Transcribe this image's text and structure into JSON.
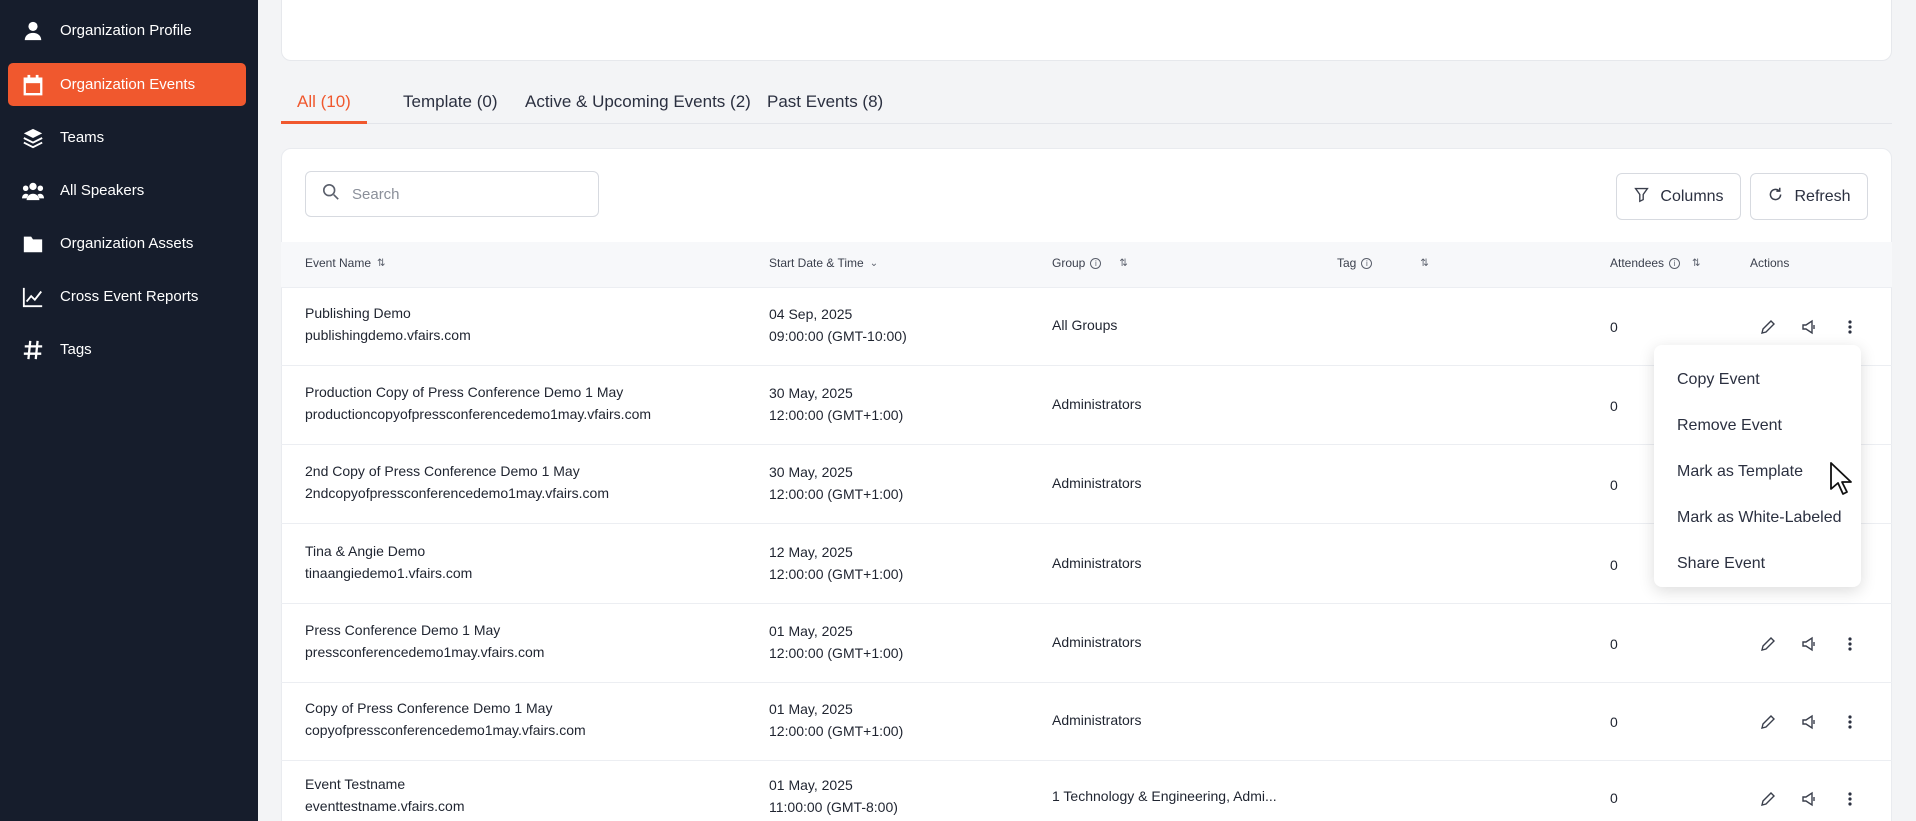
{
  "sidebar": {
    "items": [
      {
        "label": "Organization Profile",
        "icon": "user-icon"
      },
      {
        "label": "Organization Events",
        "icon": "calendar-icon",
        "active": true
      },
      {
        "label": "Teams",
        "icon": "layers-icon"
      },
      {
        "label": "All Speakers",
        "icon": "users-icon"
      },
      {
        "label": "Organization Assets",
        "icon": "folder-icon"
      },
      {
        "label": "Cross Event Reports",
        "icon": "chart-line-icon"
      },
      {
        "label": "Tags",
        "icon": "hash-icon"
      }
    ]
  },
  "tabs": [
    {
      "label": "All (10)",
      "active": true
    },
    {
      "label": "Template (0)"
    },
    {
      "label": "Active & Upcoming Events (2)"
    },
    {
      "label": "Past Events (8)"
    }
  ],
  "toolbar": {
    "search_placeholder": "Search",
    "columns_label": "Columns",
    "refresh_label": "Refresh"
  },
  "table": {
    "headers": {
      "event_name": "Event Name",
      "start_date": "Start Date & Time",
      "group": "Group",
      "tag": "Tag",
      "attendees": "Attendees",
      "actions": "Actions"
    },
    "rows": [
      {
        "name": "Publishing Demo",
        "url": "publishingdemo.vfairs.com",
        "date": "04 Sep, 2025",
        "time": "09:00:00 (GMT-10:00)",
        "group": "All Groups",
        "tag": "",
        "attendees": "0"
      },
      {
        "name": "Production Copy of Press Conference Demo 1 May",
        "url": "productioncopyofpressconferencedemo1may.vfairs.com",
        "date": "30 May, 2025",
        "time": "12:00:00 (GMT+1:00)",
        "group": "Administrators",
        "tag": "",
        "attendees": "0"
      },
      {
        "name": "2nd Copy of Press Conference Demo 1 May",
        "url": "2ndcopyofpressconferencedemo1may.vfairs.com",
        "date": "30 May, 2025",
        "time": "12:00:00 (GMT+1:00)",
        "group": "Administrators",
        "tag": "",
        "attendees": "0"
      },
      {
        "name": "Tina & Angie Demo",
        "url": "tinaangiedemo1.vfairs.com",
        "date": "12 May, 2025",
        "time": "12:00:00 (GMT+1:00)",
        "group": "Administrators",
        "tag": "",
        "attendees": "0"
      },
      {
        "name": "Press Conference Demo 1 May",
        "url": "pressconferencedemo1may.vfairs.com",
        "date": "01 May, 2025",
        "time": "12:00:00 (GMT+1:00)",
        "group": "Administrators",
        "tag": "",
        "attendees": "0"
      },
      {
        "name": "Copy of Press Conference Demo 1 May",
        "url": "copyofpressconferencedemo1may.vfairs.com",
        "date": "01 May, 2025",
        "time": "12:00:00 (GMT+1:00)",
        "group": "Administrators",
        "tag": "",
        "attendees": "0"
      },
      {
        "name": "Event Testname",
        "url": "eventtestname.vfairs.com",
        "date": "01 May, 2025",
        "time": "11:00:00 (GMT-8:00)",
        "group": "1 Technology & Engineering, Admi...",
        "tag": "",
        "attendees": "0"
      }
    ]
  },
  "dropdown": {
    "items": [
      "Copy Event",
      "Remove Event",
      "Mark as Template",
      "Mark as White-Labeled",
      "Share Event"
    ]
  },
  "colors": {
    "accent": "#f0582e",
    "sidebar_bg": "#161d2c"
  }
}
